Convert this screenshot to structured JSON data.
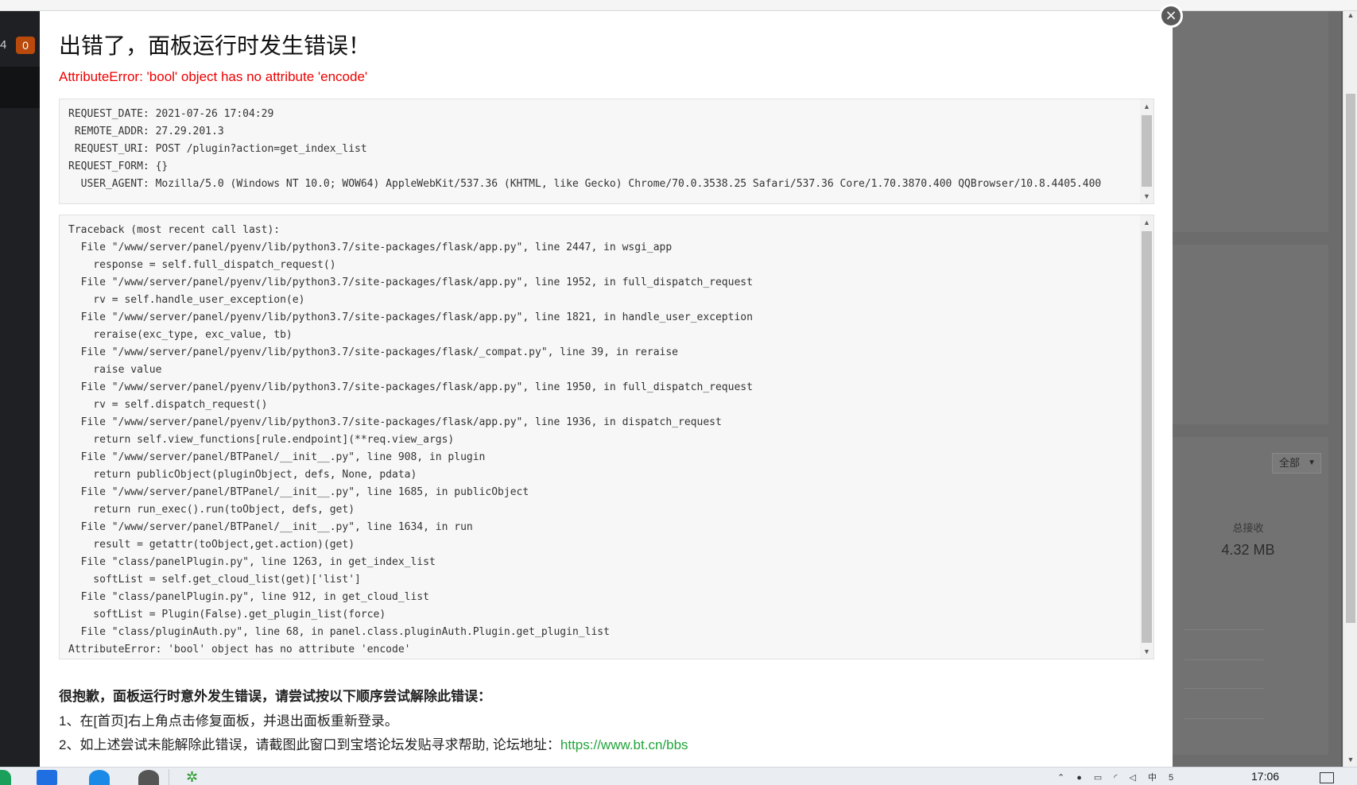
{
  "dialog": {
    "title": "出错了，面板运行时发生错误！",
    "error_summary": "AttributeError: 'bool' object has no attribute 'encode'",
    "close_icon": "close-icon",
    "close_glyph": "×",
    "request_info": [
      "REQUEST_DATE: 2021-07-26 17:04:29",
      " REMOTE_ADDR: 27.29.201.3",
      " REQUEST_URI: POST /plugin?action=get_index_list",
      "REQUEST_FORM: {}",
      "  USER_AGENT: Mozilla/5.0 (Windows NT 10.0; WOW64) AppleWebKit/537.36 (KHTML, like Gecko) Chrome/70.0.3538.25 Safari/537.36 Core/1.70.3870.400 QQBrowser/10.8.4405.400"
    ],
    "traceback": [
      "Traceback (most recent call last):",
      "  File \"/www/server/panel/pyenv/lib/python3.7/site-packages/flask/app.py\", line 2447, in wsgi_app",
      "    response = self.full_dispatch_request()",
      "  File \"/www/server/panel/pyenv/lib/python3.7/site-packages/flask/app.py\", line 1952, in full_dispatch_request",
      "    rv = self.handle_user_exception(e)",
      "  File \"/www/server/panel/pyenv/lib/python3.7/site-packages/flask/app.py\", line 1821, in handle_user_exception",
      "    reraise(exc_type, exc_value, tb)",
      "  File \"/www/server/panel/pyenv/lib/python3.7/site-packages/flask/_compat.py\", line 39, in reraise",
      "    raise value",
      "  File \"/www/server/panel/pyenv/lib/python3.7/site-packages/flask/app.py\", line 1950, in full_dispatch_request",
      "    rv = self.dispatch_request()",
      "  File \"/www/server/panel/pyenv/lib/python3.7/site-packages/flask/app.py\", line 1936, in dispatch_request",
      "    return self.view_functions[rule.endpoint](**req.view_args)",
      "  File \"/www/server/panel/BTPanel/__init__.py\", line 908, in plugin",
      "    return publicObject(pluginObject, defs, None, pdata)",
      "  File \"/www/server/panel/BTPanel/__init__.py\", line 1685, in publicObject",
      "    return run_exec().run(toObject, defs, get)",
      "  File \"/www/server/panel/BTPanel/__init__.py\", line 1634, in run",
      "    result = getattr(toObject,get.action)(get)",
      "  File \"class/panelPlugin.py\", line 1263, in get_index_list",
      "    softList = self.get_cloud_list(get)['list']",
      "  File \"class/panelPlugin.py\", line 912, in get_cloud_list",
      "    softList = Plugin(False).get_plugin_list(force)",
      "  File \"class/pluginAuth.py\", line 68, in panel.class.pluginAuth.Plugin.get_plugin_list",
      "AttributeError: 'bool' object has no attribute 'encode'"
    ],
    "help_title": "很抱歉，面板运行时意外发生错误，请尝试按以下顺序尝试解除此错误：",
    "help_step_1": "1、在[首页]右上角点击修复面板，并退出面板重新登录。",
    "help_step_2_text": "2、如上述尝试未能解除此错误，请截图此窗口到宝塔论坛发贴寻求帮助, 论坛地址：",
    "help_step_2_link": "https://www.bt.cn/bbs",
    "link_color": "#20a53a",
    "error_color": "#ee0000"
  },
  "background": {
    "sidebar_count": "4",
    "sidebar_badge": "0",
    "filter_label": "全部",
    "filter_arrow": "▼",
    "stat_label": "总接收",
    "stat_value": "4.32 MB"
  },
  "scroll_arrows": {
    "up": "▲",
    "down": "▼"
  },
  "taskbar": {
    "clock": "17:06",
    "tray_icons": [
      "up-chevron-icon",
      "person-icon",
      "network-icon",
      "wifi-icon",
      "volume-icon",
      "ime-icon",
      "html5-icon"
    ],
    "tray_glyphs": [
      "⌃",
      "●",
      "▭",
      "◜",
      "◁",
      "中",
      "5"
    ]
  }
}
